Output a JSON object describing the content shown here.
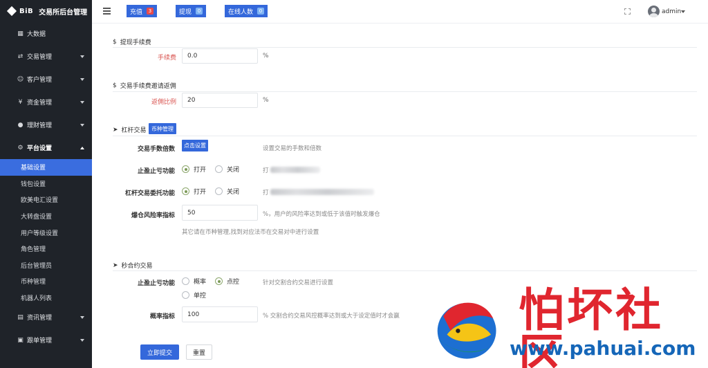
{
  "brand": {
    "logo_text": "BiB",
    "title": "交易所后台管理"
  },
  "sidebar": {
    "items": [
      {
        "label": "大数据",
        "icon": "chart-icon"
      },
      {
        "label": "交易管理",
        "icon": "exchange-icon"
      },
      {
        "label": "客户管理",
        "icon": "users-icon"
      },
      {
        "label": "资金管理",
        "icon": "money-bag-icon"
      },
      {
        "label": "理财管理",
        "icon": "piggy-bank-icon"
      },
      {
        "label": "平台设置",
        "icon": "settings-icon"
      }
    ],
    "sub_items": [
      "基础设置",
      "钱包设置",
      "欧美电汇设置",
      "大转盘设置",
      "用户等级设置",
      "角色管理",
      "后台管理员",
      "币种管理",
      "机器人列表"
    ],
    "bottom_items": [
      {
        "label": "资讯管理",
        "icon": "news-icon"
      },
      {
        "label": "跟单管理",
        "icon": "copy-trade-icon"
      }
    ]
  },
  "topbar": {
    "recharge_label": "充值",
    "recharge_count": "3",
    "withdraw_label": "提现",
    "withdraw_count": "0",
    "online_label": "在线人数",
    "online_count": "0",
    "user_name": "admin"
  },
  "withdraw_fee": {
    "title": "提现手续费",
    "fee_label": "手续费",
    "fee_value": "0.0",
    "fee_unit": "%"
  },
  "rebate": {
    "title": "交易手续费邀请返佣",
    "ratio_label": "返佣比例",
    "ratio_value": "20",
    "ratio_unit": "%"
  },
  "leverage": {
    "title": "杠杆交易",
    "coin_mgmt_button": "币种管理",
    "multiplier_label": "交易手数倍数",
    "multiplier_button": "点击设置",
    "multiplier_hint": "设置交易的手数和倍数",
    "stop_label": "止盈止亏功能",
    "stop_on": "打开",
    "stop_off": "关闭",
    "stop_hint": "打",
    "entrust_label": "杠杆交易委托功能",
    "entrust_on": "打开",
    "entrust_off": "关闭",
    "entrust_hint": "打",
    "liquidation_label": "爆仓风险率指标",
    "liquidation_value": "50",
    "liquidation_hint": "%，用户的风险率达到或低于该值时触发爆仓",
    "footnote": "其它请在币种管理,找到对应法币在交易对中进行设置"
  },
  "seconds_contract": {
    "title": "秒合约交易",
    "stop_label": "止盈止亏功能",
    "opt_probability": "概率",
    "opt_point": "点控",
    "opt_single": "单控",
    "stop_hint": "针对交割合约交易进行设置",
    "prob_label": "概率指标",
    "prob_value": "100",
    "prob_hint": "%  交割合约交易风控概率达到或大于设定值时才会赢"
  },
  "actions": {
    "submit": "立即提交",
    "reset": "重置"
  },
  "watermark": {
    "title": "怕坏社区",
    "url": "www.pahuai.com"
  }
}
